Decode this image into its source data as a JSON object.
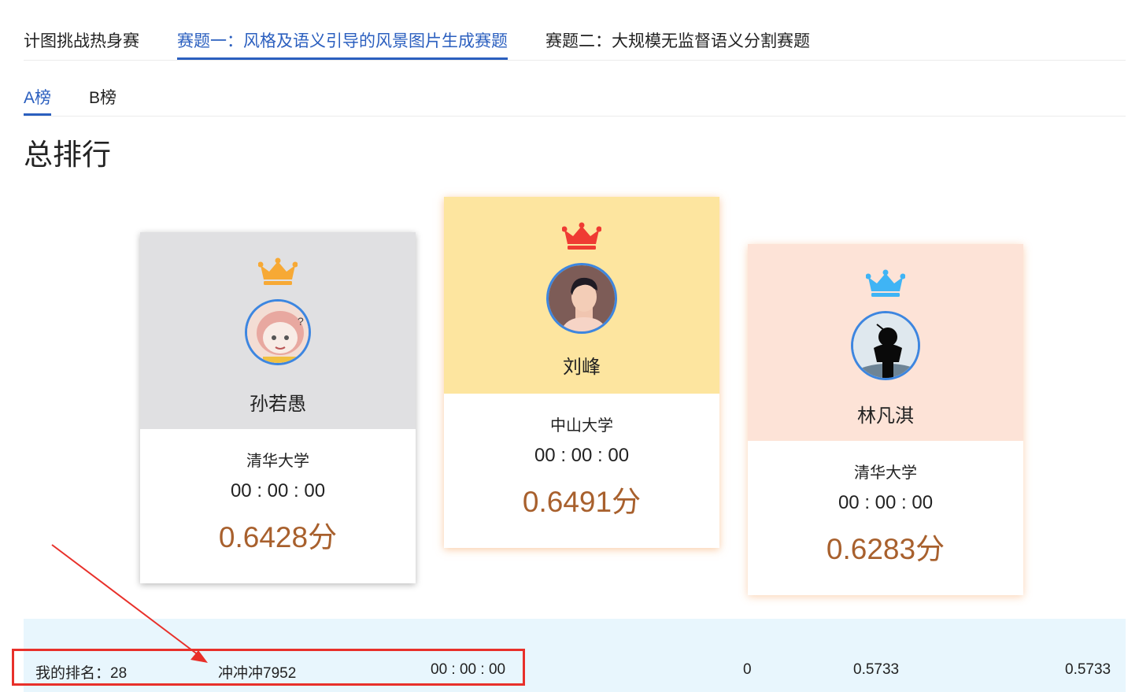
{
  "tabs": [
    {
      "label": "计图挑战热身赛"
    },
    {
      "label": "赛题一：风格及语义引导的风景图片生成赛题"
    },
    {
      "label": "赛题二：大规模无监督语义分割赛题"
    }
  ],
  "subtabs": [
    {
      "label": "A榜"
    },
    {
      "label": "B榜"
    }
  ],
  "page_title": "总排行",
  "podium": {
    "second": {
      "name": "孙若愚",
      "university": "清华大学",
      "time": "00 : 00 : 00",
      "score": "0.6428分",
      "crown_icon": "crown-orange-icon",
      "crown_color": "#f7a935",
      "bg_color": "#e0e0e2"
    },
    "first": {
      "name": "刘峰",
      "university": "中山大学",
      "time": "00 : 00 : 00",
      "score": "0.6491分",
      "crown_icon": "crown-red-icon",
      "crown_color": "#ef3b33",
      "bg_color": "#fde59f"
    },
    "third": {
      "name": "林凡淇",
      "university": "清华大学",
      "time": "00 : 00 : 00",
      "score": "0.6283分",
      "crown_icon": "crown-blue-icon",
      "crown_color": "#3fb4f5",
      "bg_color": "#fde3d7"
    }
  },
  "my_rank": {
    "label": "我的排名：28",
    "name": "冲冲冲7952",
    "time": "00 : 00 : 00",
    "col1": "0",
    "col2": "0.5733",
    "col3": "0.5733"
  },
  "colors": {
    "accent": "#2b5fbf",
    "score": "#a8602d",
    "annotation": "#e8302a",
    "rank_bar": "#e8f6fd"
  }
}
